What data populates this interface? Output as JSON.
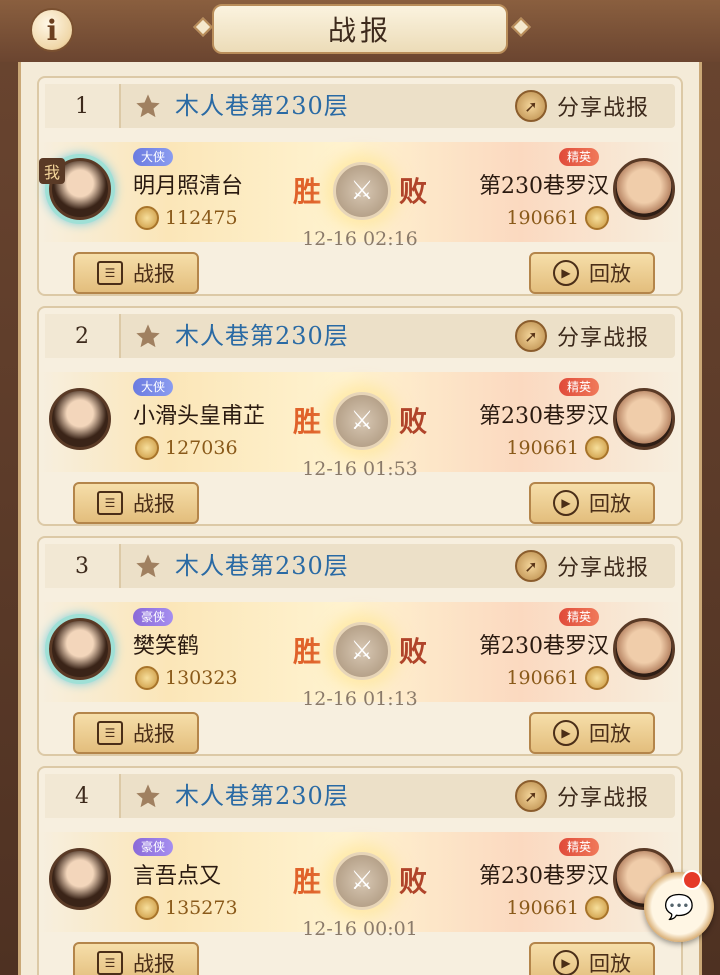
{
  "header": {
    "title": "战报",
    "info_icon": "i"
  },
  "colors": {
    "floor_text": "#2a6aa4",
    "win": "#e0622a",
    "lose": "#b0442a",
    "power": "#8a5a1a"
  },
  "reports": [
    {
      "rank": "1",
      "floor": "木人巷第230层",
      "share_label": "分享战报",
      "left": {
        "me_tag": "我",
        "title": "大侠",
        "name": "明月照清台",
        "power": "112475"
      },
      "result_left": "胜",
      "result_right": "败",
      "right": {
        "title": "精英",
        "name": "第230巷罗汉",
        "power": "190661"
      },
      "time": "12-16 02:16",
      "report_label": "战报",
      "replay_label": "回放"
    },
    {
      "rank": "2",
      "floor": "木人巷第230层",
      "share_label": "分享战报",
      "left": {
        "title": "大侠",
        "name": "小滑头皇甫芷",
        "power": "127036"
      },
      "result_left": "胜",
      "result_right": "败",
      "right": {
        "title": "精英",
        "name": "第230巷罗汉",
        "power": "190661"
      },
      "time": "12-16 01:53",
      "report_label": "战报",
      "replay_label": "回放"
    },
    {
      "rank": "3",
      "floor": "木人巷第230层",
      "share_label": "分享战报",
      "left": {
        "title": "豪侠",
        "name": "樊笑鹤",
        "power": "130323"
      },
      "result_left": "胜",
      "result_right": "败",
      "right": {
        "title": "精英",
        "name": "第230巷罗汉",
        "power": "190661"
      },
      "time": "12-16 01:13",
      "report_label": "战报",
      "replay_label": "回放"
    },
    {
      "rank": "4",
      "floor": "木人巷第230层",
      "share_label": "分享战报",
      "left": {
        "title": "豪侠",
        "name": "言吾点又",
        "power": "135273"
      },
      "result_left": "胜",
      "result_right": "败",
      "right": {
        "title": "精英",
        "name": "第230巷罗汉",
        "power": "190661"
      },
      "time": "12-16 00:01",
      "report_label": "战报",
      "replay_label": "回放"
    }
  ]
}
